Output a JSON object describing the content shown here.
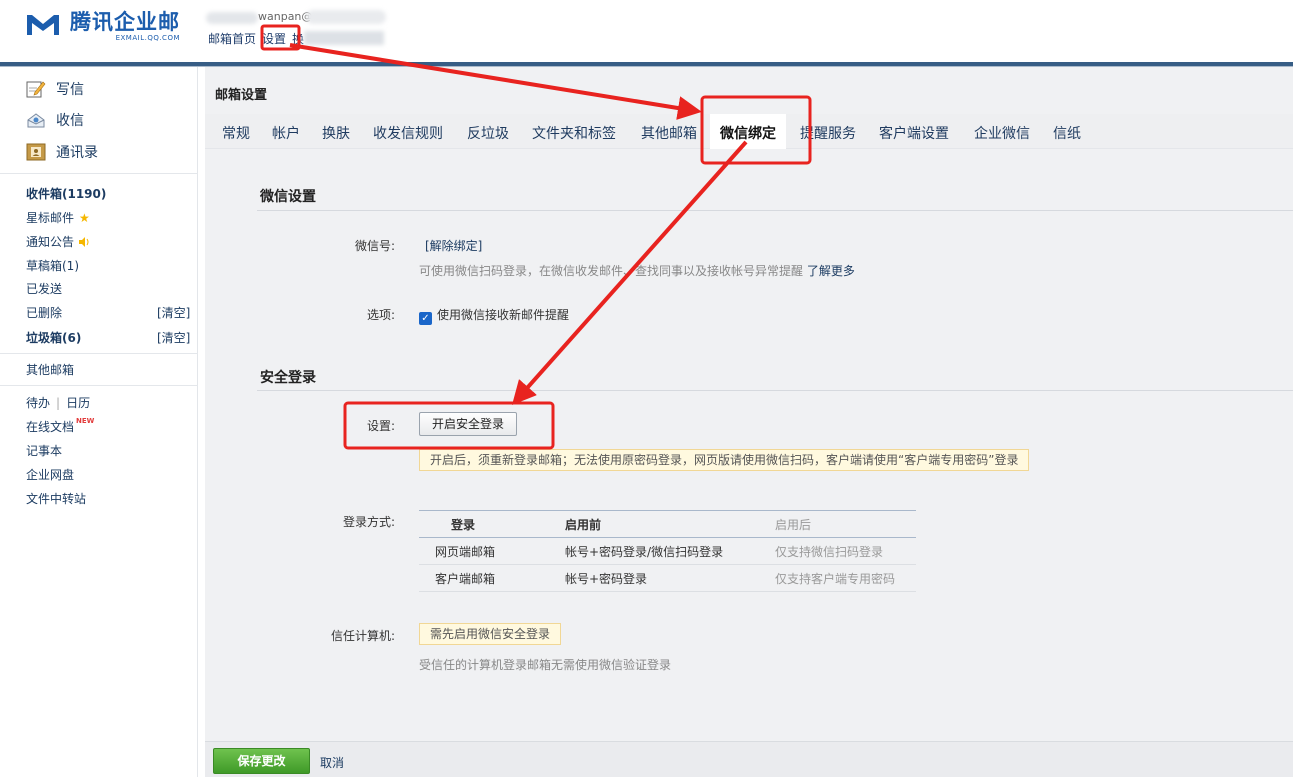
{
  "header": {
    "logo_text": "腾讯企业邮",
    "logo_sub": "EXMAIL.QQ.COM",
    "user_email_partial": "wanpan@",
    "links": {
      "home": "邮箱首页",
      "settings": "设置",
      "switch_partial": "换"
    }
  },
  "sidebar": {
    "compose": "写信",
    "inbox_check": "收信",
    "contacts": "通讯录",
    "inbox": "收件箱(1190)",
    "starred": "星标邮件",
    "notice": "通知公告",
    "drafts": "草稿箱(1)",
    "sent": "已发送",
    "deleted": "已删除",
    "deleted_clear": "[清空]",
    "junk": "垃圾箱(6)",
    "junk_clear": "[清空]",
    "other_mail": "其他邮箱",
    "todo": "待办",
    "separator": "|",
    "calendar": "日历",
    "docs": "在线文档",
    "new_badge": "NEW",
    "notes": "记事本",
    "netdisk": "企业网盘",
    "transfer": "文件中转站"
  },
  "main": {
    "title": "邮箱设置",
    "tabs": [
      {
        "label": "常规"
      },
      {
        "label": "帐户"
      },
      {
        "label": "换肤"
      },
      {
        "label": "收发信规则"
      },
      {
        "label": "反垃圾"
      },
      {
        "label": "文件夹和标签"
      },
      {
        "label": "其他邮箱"
      },
      {
        "label": "微信绑定",
        "active": true
      },
      {
        "label": "提醒服务"
      },
      {
        "label": "客户端设置"
      },
      {
        "label": "企业微信"
      },
      {
        "label": "信纸"
      }
    ],
    "wechat_section": {
      "title": "微信设置",
      "wechat_id_label": "微信号:",
      "unbind": "[解除绑定]",
      "desc": "可使用微信扫码登录，在微信收发邮件、查找同事以及接收帐号异常提醒",
      "learn_more": "了解更多",
      "option_label": "选项:",
      "option_text": "使用微信接收新邮件提醒",
      "option_checked": true
    },
    "secure_section": {
      "title": "安全登录",
      "setting_label": "设置:",
      "enable_button": "开启安全登录",
      "notice": "开启后，须重新登录邮箱；无法使用原密码登录，网页版请使用微信扫码，客户端请使用“客户端专用密码”登录",
      "login_method_label": "登录方式:",
      "table": {
        "headers": [
          "登录",
          "启用前",
          "启用后"
        ],
        "rows": [
          [
            "网页端邮箱",
            "帐号+密码登录/微信扫码登录",
            "仅支持微信扫码登录"
          ],
          [
            "客户端邮箱",
            "帐号+密码登录",
            "仅支持客户端专用密码"
          ]
        ]
      },
      "trusted_label": "信任计算机:",
      "trusted_notice": "需先启用微信安全登录",
      "trusted_desc": "受信任的计算机登录邮箱无需使用微信验证登录"
    },
    "save_button": "保存更改",
    "cancel": "取消"
  },
  "colors": {
    "brand": "#1c5dad",
    "annotation_red": "#e8231f",
    "save_green": "#4fa834"
  }
}
